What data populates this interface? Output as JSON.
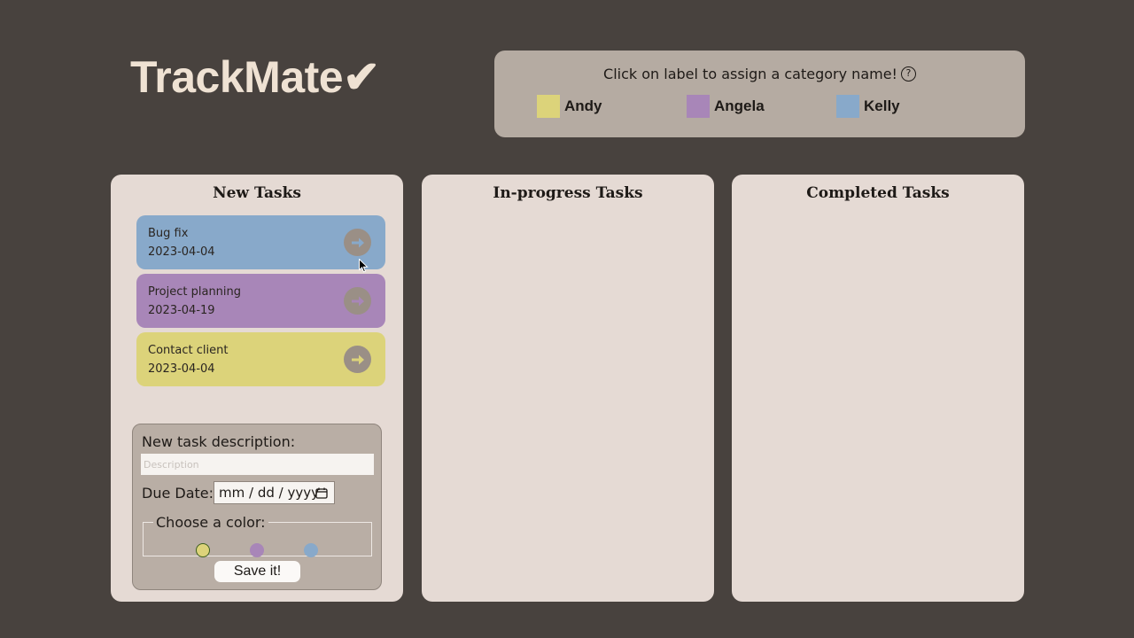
{
  "app": {
    "logo": "TrackMate✔"
  },
  "legend": {
    "hint": "Click on label to assign a category name!",
    "help_icon": "question-circle-icon",
    "items": [
      {
        "name": "Andy",
        "color": "#dcd37a"
      },
      {
        "name": "Angela",
        "color": "#a886b8"
      },
      {
        "name": "Kelly",
        "color": "#88a9ca"
      }
    ]
  },
  "columns": {
    "new": {
      "title": "New Tasks"
    },
    "in_progress": {
      "title": "In-progress Tasks"
    },
    "completed": {
      "title": "Completed Tasks"
    }
  },
  "tasks": [
    {
      "description": "Bug fix",
      "due": "2023-04-04",
      "color": "#88a9ca"
    },
    {
      "description": "Project planning",
      "due": "2023-04-19",
      "color": "#a886b8"
    },
    {
      "description": "Contact client",
      "due": "2023-04-04",
      "color": "#dcd37a"
    }
  ],
  "form": {
    "description_label": "New task description:",
    "description_placeholder": "Description",
    "description_value": "",
    "due_label": "Due Date:",
    "due_value": "mm / dd / yyyy",
    "color_legend": "Choose a color:",
    "color_options": [
      "#dcd37a",
      "#a886b8",
      "#88a9ca"
    ],
    "selected_color_index": 0,
    "save_label": "Save it!"
  },
  "colors": {
    "background": "#48423e",
    "panel": "#e5dad4",
    "legend_panel": "#b5aba2",
    "move_button": "#9a8f86"
  }
}
